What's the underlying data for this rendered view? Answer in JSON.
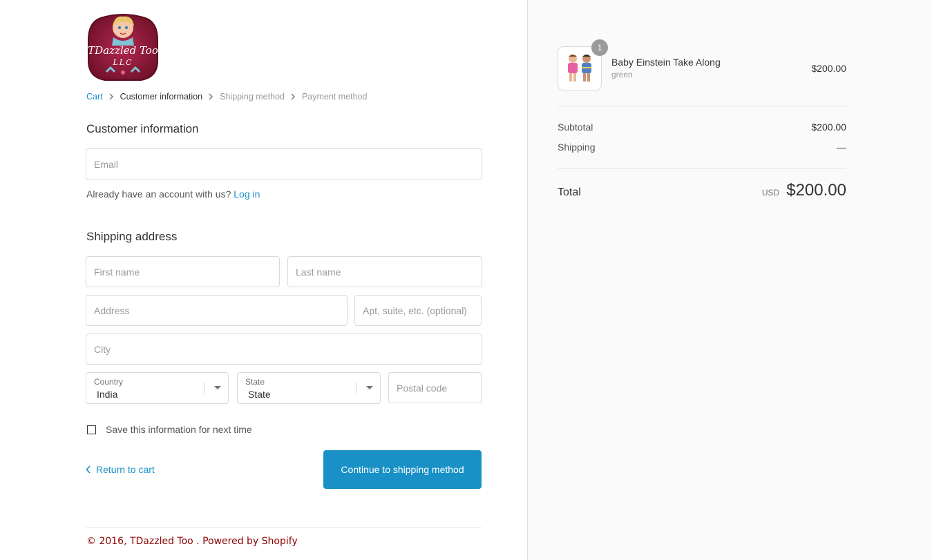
{
  "logo": {
    "text_line1": "TDazzled Too",
    "text_line2": "LLC"
  },
  "breadcrumb": [
    {
      "label": "Cart",
      "state": "link"
    },
    {
      "label": "Customer information",
      "state": "current"
    },
    {
      "label": "Shipping method",
      "state": "upcoming"
    },
    {
      "label": "Payment method",
      "state": "upcoming"
    }
  ],
  "customer": {
    "title": "Customer information",
    "email_placeholder": "Email",
    "account_prompt": "Already have an account with us?",
    "login_label": "Log in"
  },
  "shipping": {
    "title": "Shipping address",
    "first_name_placeholder": "First name",
    "last_name_placeholder": "Last name",
    "address_placeholder": "Address",
    "apt_placeholder": "Apt, suite, etc. (optional)",
    "city_placeholder": "City",
    "country_label": "Country",
    "country_value": "India",
    "state_label": "State",
    "state_value": "State",
    "postal_placeholder": "Postal code",
    "save_info_label": "Save this information for next time"
  },
  "actions": {
    "return_label": "Return to cart",
    "continue_label": "Continue to shipping method"
  },
  "footer": {
    "text": "© 2016, TDazzled Too . Powered by Shopify"
  },
  "order": {
    "item": {
      "quantity": "1",
      "name": "Baby Einstein Take Along",
      "variant": "green",
      "price": "$200.00"
    },
    "subtotal_label": "Subtotal",
    "subtotal_value": "$200.00",
    "shipping_label": "Shipping",
    "shipping_value": "—",
    "total_label": "Total",
    "currency": "USD",
    "total_value": "$200.00"
  },
  "colors": {
    "accent": "#1990c6",
    "footer_text": "#8b0000",
    "logo_red": "#8c1c3a",
    "sidebar_bg": "#fafafa"
  }
}
